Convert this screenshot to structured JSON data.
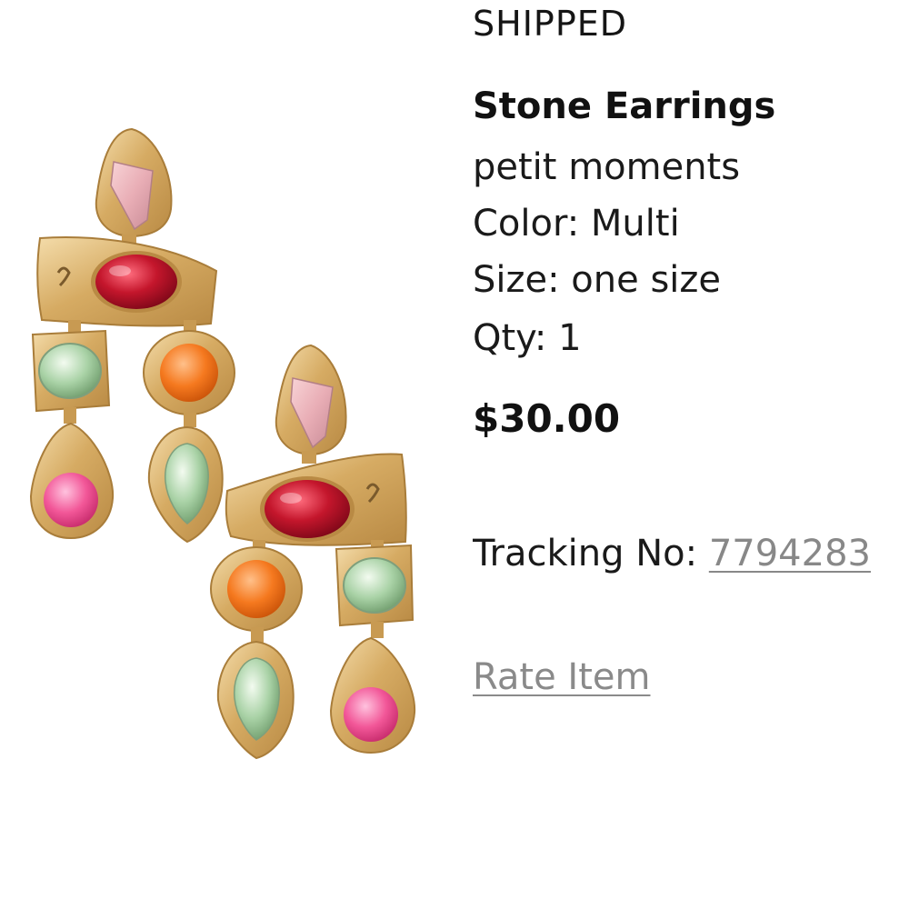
{
  "order_item": {
    "status": "SHIPPED",
    "name": "Stone Earrings",
    "brand": "petit moments",
    "color": "Color: Multi",
    "size": "Size: one size",
    "qty": "Qty: 1",
    "price": "$30.00",
    "tracking_label": "Tracking No:",
    "tracking_number": "7794283",
    "rate_label": "Rate Item"
  },
  "colors": {
    "text": "#111111",
    "link": "#888888",
    "gold": "#d8b06a",
    "red_stone": "#c4162c",
    "orange_stone": "#f5791f",
    "pink_stone": "#f25798",
    "green_stone": "#a9d2a6",
    "blush_stone": "#e9aeb6"
  }
}
